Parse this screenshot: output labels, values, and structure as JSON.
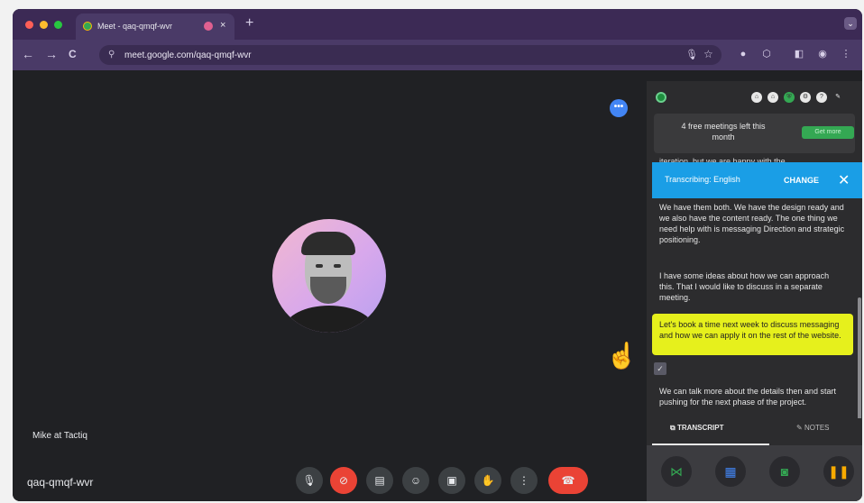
{
  "browser": {
    "tab_title": "Meet - qaq-qmqf-wvr",
    "tab_close": "×",
    "new_tab": "+",
    "tab_menu": "⌄",
    "url": "meet.google.com/qaq-qmqf-wvr",
    "nav_back": "←",
    "nav_forward": "→",
    "nav_reload": "C",
    "bookmark_star": "☆",
    "traffic_colors": [
      "#ff5f57",
      "#febc2e",
      "#28c840"
    ]
  },
  "meeting": {
    "participant_name": "Mike at Tactiq",
    "meeting_code": "qaq-qmqf-wvr",
    "more_button": "•••",
    "controls": [
      "mic-icon",
      "camera-off-icon",
      "captions-icon",
      "emoji-icon",
      "present-icon",
      "raise-hand-icon",
      "more-options-icon",
      "end-call-icon"
    ]
  },
  "panel": {
    "promo_text": "4 free meetings left this month",
    "upgrade_label": "Get more",
    "fragment_text": "iteration, but we are happy with the",
    "banner_language": "Transcribing: English",
    "banner_change": "CHANGE",
    "banner_close": "✕",
    "paragraphs": [
      "We have them both. We have the design ready and we also have the content ready. The one thing we need help with is messaging Direction and strategic positioning.",
      "I have some ideas about how we can approach this. That I would like to discuss in a separate meeting.",
      "We can talk more about the details then and start pushing for the next phase of the project."
    ],
    "highlight_text": "Let's book a time next week to discuss messaging and how we can apply it on the rest of the website.",
    "tab_transcript": "TRANSCRIPT",
    "tab_notes": "NOTES",
    "footer_buttons": [
      "share-icon",
      "document-icon",
      "screenshot-icon",
      "pause-icon"
    ]
  }
}
